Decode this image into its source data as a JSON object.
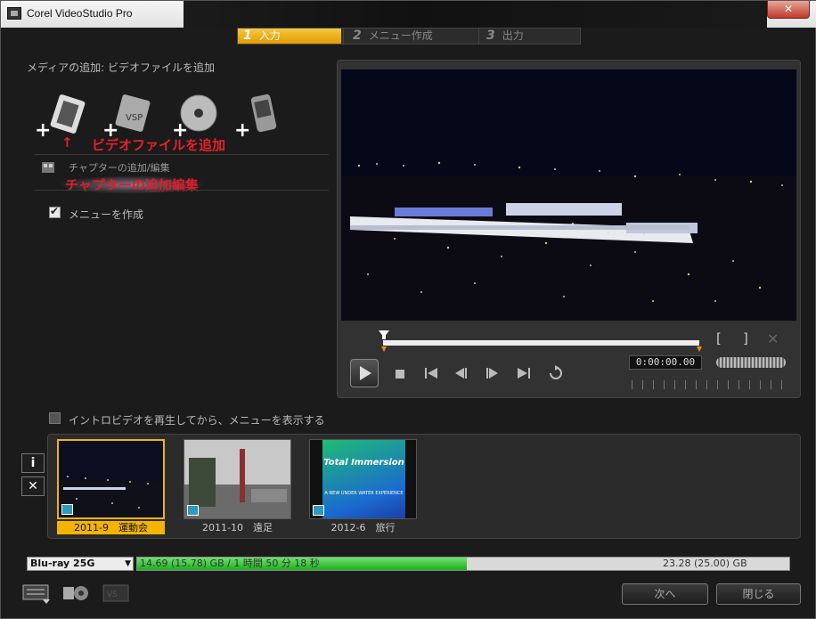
{
  "window": {
    "title": "Corel VideoStudio Pro",
    "close_glyph": "✕"
  },
  "steps": [
    {
      "num": "1",
      "label": "入力"
    },
    {
      "num": "2",
      "label": "メニュー作成"
    },
    {
      "num": "3",
      "label": "出力"
    }
  ],
  "media": {
    "header": "メディアの追加: ビデオファイルを追加",
    "annotation_add_video": "ビデオファイルを追加",
    "chapter_label": "チャプターの追加/編集",
    "annotation_chapter": "チャプターの追加編集",
    "create_menu_label": "メニューを作成",
    "create_menu_checked": true,
    "icons": [
      "add-video-icon",
      "add-vsp-project-icon",
      "add-disc-icon",
      "add-device-icon"
    ]
  },
  "player": {
    "timecode": "0:00:00.00",
    "mark_in": "[",
    "mark_out": "]"
  },
  "intro_label": "イントロビデオを再生してから、メニューを表示する",
  "intro_checked": false,
  "side_buttons": {
    "info": "i",
    "remove": "✕"
  },
  "clips": [
    {
      "caption": "2011-9　運動会",
      "selected": true
    },
    {
      "caption": "2011-10　遠足",
      "selected": false
    },
    {
      "caption": "2012-6　旅行",
      "selected": false
    }
  ],
  "clip3_overlay": {
    "title": "Total Immersion",
    "subtitle": "A NEW UNDER WATER EXPERIENCE"
  },
  "disc": {
    "type": "Blu-ray 25G",
    "used_text": "14.69 (15.78) GB / 1 時間 50 分 18 秒",
    "capacity_text": "23.28 (25.00) GB",
    "used_fraction": 0.505
  },
  "buttons": {
    "next": "次へ",
    "close": "閉じる"
  }
}
